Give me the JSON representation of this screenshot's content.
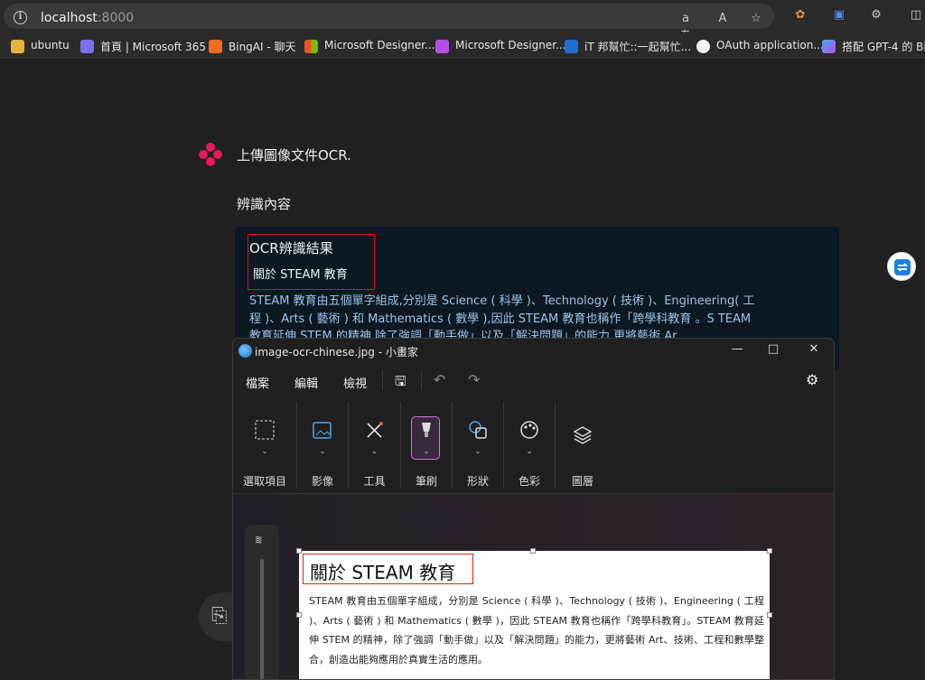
{
  "browser": {
    "url_host": "localhost",
    "url_port": ":8000",
    "bookmarks": [
      {
        "label": "ubuntu",
        "color": "#e9b13b"
      },
      {
        "label": "首頁 | Microsoft 365",
        "color": "#7b6ff0"
      },
      {
        "label": "BingAI - 聊天",
        "color": "#f26b21"
      },
      {
        "label": "Microsoft Designer...",
        "color": "#f25022"
      },
      {
        "label": "Microsoft Designer...",
        "color": "#b84de8"
      },
      {
        "label": "iT 邦幫忙::一起幫忙...",
        "color": "#1d6fd6"
      },
      {
        "label": "OAuth application...",
        "color": "#f0f0f0"
      },
      {
        "label": "搭配 GPT-4 的 Bing",
        "color": "#4aa8f0"
      }
    ]
  },
  "chat": {
    "title": "上傳圖像文件OCR.",
    "subtitle": "辨識內容",
    "ocr_heading": "OCR辨識結果",
    "ocr_subheading": "關於 STEAM 教育",
    "ocr_body": "STEAM 教育由五個單字組成,分別是 Science ( 科學 )、Technology ( 技術 )、Engineering( 工程 )、Arts ( 藝術 ) 和 Mathematics ( 數學 ),因此 STEAM 教育也稱作「跨學科教育 。S TEAM 教育延伸 STEM 的精神 除了強調「動手做」以及「解決問題」的能力 更將藝術 Ar"
  },
  "paint": {
    "window_title": "image-ocr-chinese.jpg - 小畫家",
    "menu": [
      "檔案",
      "編輯",
      "檢視"
    ],
    "tools": [
      "選取項目",
      "影像",
      "工具",
      "筆刷",
      "形狀",
      "色彩",
      "圖層"
    ],
    "doc_title": "關於 STEAM 教育",
    "doc_body": "STEAM 教育由五個單字組成，分別是 Science ( 科學 )、Technology ( 技術 )、Engineering ( 工程 )、Arts ( 藝術 ) 和 Mathematics ( 數學 )，因此 STEAM 教育也稱作「跨學科教育」。STEAM 教育延伸 STEM 的精神，除了強調「動手做」以及「解決問題」的能力，更將藝術 Art、技術、工程和數學整合，創造出能夠應用於真實生活的應用。"
  }
}
